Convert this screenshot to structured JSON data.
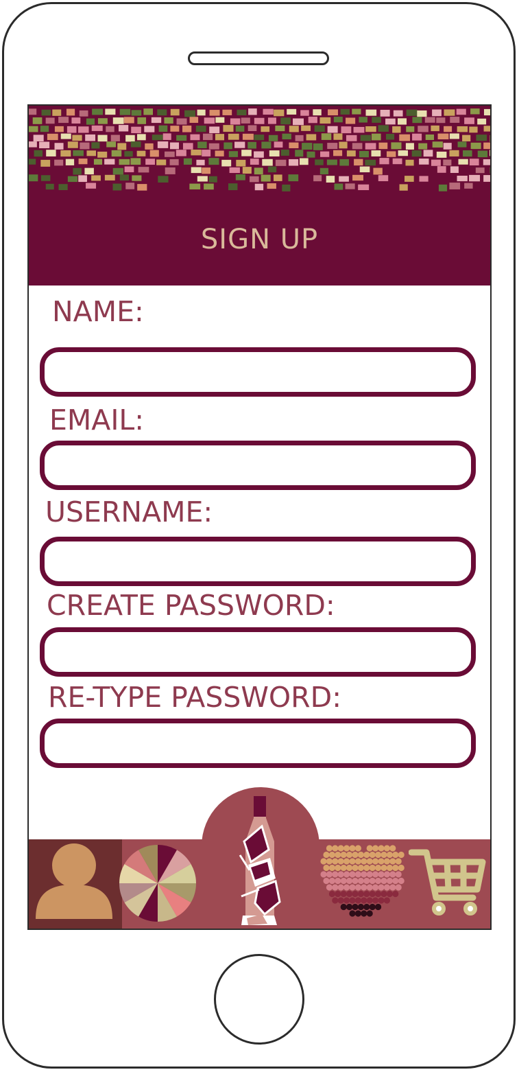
{
  "header": {
    "title": "SIGN UP"
  },
  "form": {
    "fields": [
      {
        "label": "NAME:",
        "value": ""
      },
      {
        "label": "EMAIL:",
        "value": ""
      },
      {
        "label": "USERNAME:",
        "value": ""
      },
      {
        "label": "CREATE PASSWORD:",
        "value": ""
      },
      {
        "label": "RE-TYPE PASSWORD:",
        "value": ""
      }
    ]
  },
  "nav": {
    "items": [
      {
        "icon": "profile-icon"
      },
      {
        "icon": "wine-wheel-icon"
      },
      {
        "icon": "wine-bottle-icon"
      },
      {
        "icon": "grape-heart-icon"
      },
      {
        "icon": "shopping-cart-icon"
      }
    ]
  },
  "colors": {
    "brand": "#6a0c36",
    "label": "#8e3a4f",
    "title": "#d9b99a",
    "nav": "#9e4a52",
    "nav_active": "#6c2e2f"
  }
}
